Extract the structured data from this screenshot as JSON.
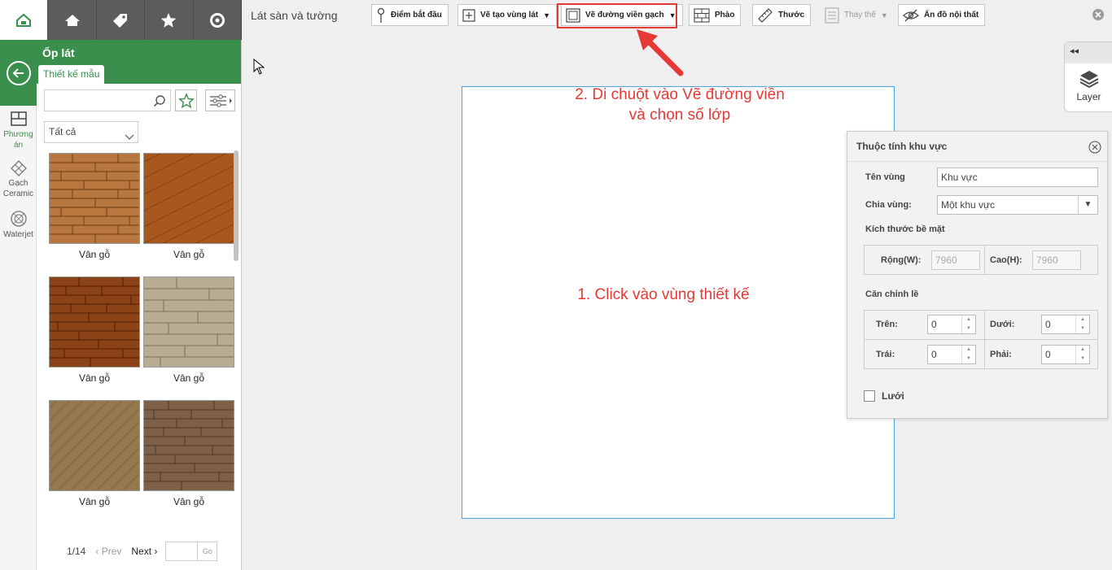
{
  "top_tabs": [
    {
      "name": "logo-tab",
      "icon": "logo-icon"
    },
    {
      "name": "house-tab",
      "icon": "house-icon"
    },
    {
      "name": "tag-tab",
      "icon": "tag-icon"
    },
    {
      "name": "star-tab",
      "icon": "star-icon"
    },
    {
      "name": "search-tab",
      "icon": "search-icon"
    }
  ],
  "rail": {
    "items": [
      {
        "label_line1": "Phương",
        "label_line2": "án"
      },
      {
        "label_line1": "Gạch",
        "label_line2": "Ceramic"
      },
      {
        "label_line1": "Waterjet",
        "label_line2": ""
      }
    ]
  },
  "panel": {
    "title": "Ốp lát",
    "tab_label": "Thiết kế mẫu",
    "search_placeholder": "",
    "filter_value": "Tất cả",
    "tiles": [
      {
        "label": "Vân gỗ",
        "texture": "#b8773e"
      },
      {
        "label": "Vân gỗ",
        "texture": "#a8581d"
      },
      {
        "label": "Vân gỗ",
        "texture": "#8b4217"
      },
      {
        "label": "Vân gỗ",
        "texture": "#b9ac95"
      },
      {
        "label": "Vân gỗ",
        "texture": "#94784f"
      },
      {
        "label": "Vân gỗ",
        "texture": "#7e5f47"
      }
    ],
    "pager": {
      "current": "1/14",
      "prev": "Prev",
      "next": "Next",
      "go": "Go"
    }
  },
  "toolbar": {
    "title": "Lát sàn và tường",
    "buttons": {
      "start_point": "Điểm bắt đầu",
      "create_area": "Vẽ tạo vùng lát",
      "draw_border": "Vẽ đường viền gạch",
      "molding": "Phào",
      "ruler": "Thước",
      "replace": "Thay thế",
      "hide_furniture": "Ẩn đồ nội thất"
    }
  },
  "annotations": {
    "step2_line1": "2. Di chuột vào Vẽ đường viền",
    "step2_line2": "và chọn số lớp",
    "step1": "1. Click vào vùng thiết kế"
  },
  "layer": {
    "collapse": "◂◂",
    "label": "Layer"
  },
  "props": {
    "title": "Thuộc tính khu vực",
    "region_name_label": "Tên vùng",
    "region_name_value": "Khu vực",
    "split_label": "Chia vùng:",
    "split_value": "Một khu vực",
    "surface_size_label": "Kích thước bề mặt",
    "width_label": "Rộng(W):",
    "width_value": "7960",
    "height_label": "Cao(H):",
    "height_value": "7960",
    "align_label": "Căn chỉnh lề",
    "top_label": "Trên:",
    "top_value": "0",
    "bottom_label": "Dưới:",
    "bottom_value": "0",
    "left_label": "Trái:",
    "left_value": "0",
    "right_label": "Phải:",
    "right_value": "0",
    "grid_label": "Lưới"
  },
  "colors": {
    "brand_green": "#3a8f4c",
    "highlight_red": "#e53935",
    "canvas_border": "#4aa3df"
  }
}
